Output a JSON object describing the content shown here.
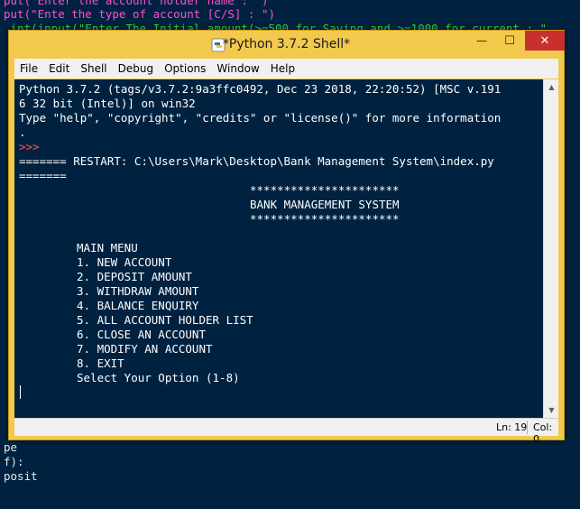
{
  "background_editor": {
    "lines": [
      "put(\"Enter the account holder name : \")",
      "put(\"Ente the type of account [C/S] : \")",
      " int(input(\"Enter The Initial amount(>=500 for Saving and >=1000 for current : \"",
      "pe",
      "f):",
      "posit"
    ]
  },
  "shell": {
    "title": "*Python 3.7.2 Shell*",
    "window_buttons": {
      "minimize": "—",
      "maximize": "☐",
      "close": "✕"
    },
    "menu": [
      "File",
      "Edit",
      "Shell",
      "Debug",
      "Options",
      "Window",
      "Help"
    ],
    "lines": {
      "banner1": "Python 3.7.2 (tags/v3.7.2:9a3ffc0492, Dec 23 2018, 22:20:52) [MSC v.191",
      "banner2": "6 32 bit (Intel)] on win32",
      "banner3": "Type \"help\", \"copyright\", \"credits\" or \"license()\" for more information",
      "banner4": ".",
      "prompt": ">>>",
      "restart1": "======= RESTART: C:\\Users\\Mark\\Desktop\\Bank Management System\\index.py",
      "restart2": "=======",
      "stars_top": "**********************",
      "heading": "BANK MANAGEMENT SYSTEM",
      "stars_bottom": "**********************",
      "main_menu": "MAIN MENU",
      "opt1": "1. NEW ACCOUNT",
      "opt2": "2. DEPOSIT AMOUNT",
      "opt3": "3. WITHDRAW AMOUNT",
      "opt4": "4. BALANCE ENQUIRY",
      "opt5": "5. ALL ACCOUNT HOLDER LIST",
      "opt6": "6. CLOSE AN ACCOUNT",
      "opt7": "7. MODIFY AN ACCOUNT",
      "opt8": "8. EXIT",
      "select": "Select Your Option (1-8)"
    },
    "status": {
      "line": "Ln: 19",
      "col": "Col: 0"
    }
  }
}
